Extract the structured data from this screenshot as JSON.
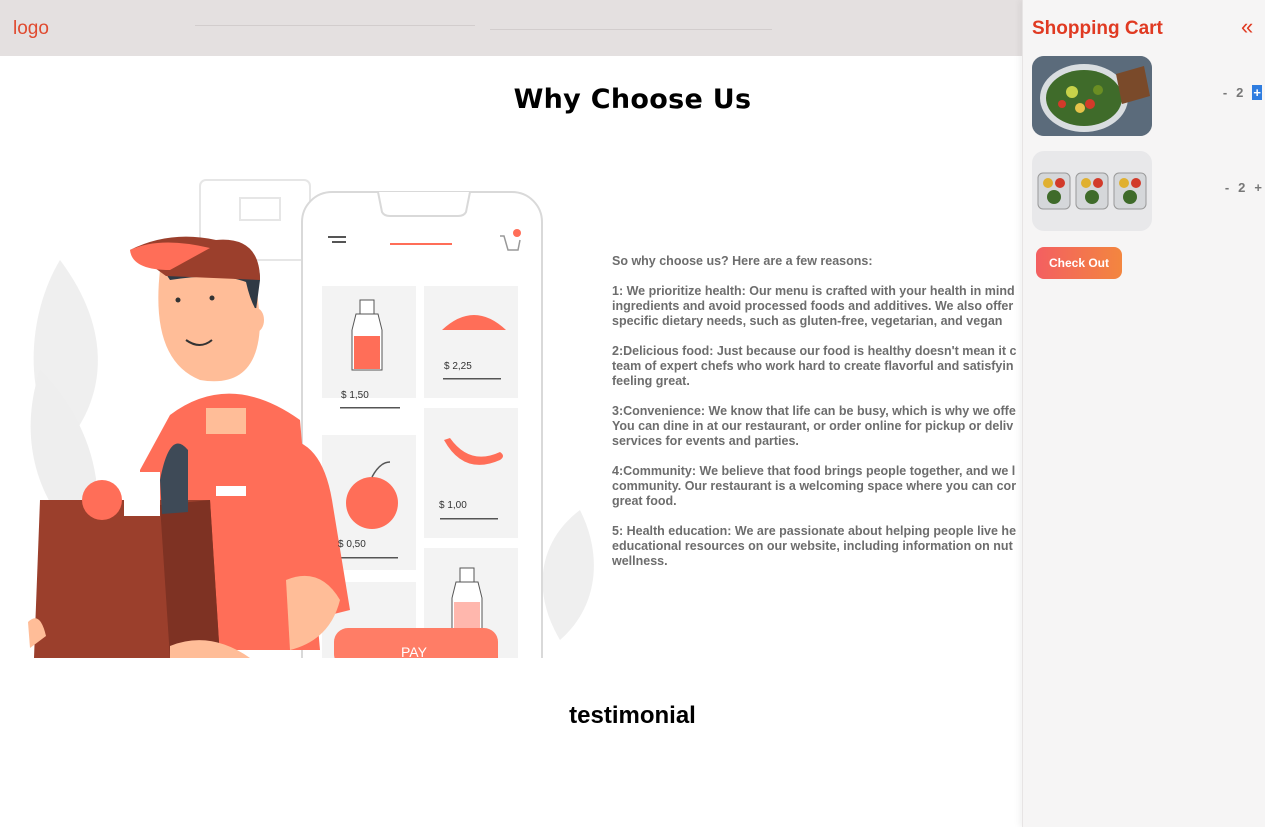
{
  "header": {
    "logo": "logo"
  },
  "why": {
    "title": "Why Choose Us",
    "intro": "So why choose us? Here are a few reasons:",
    "reasons": [
      [
        "1: We prioritize health: Our menu is crafted with your health in mind",
        "ingredients and avoid processed foods and additives. We also offer",
        "specific dietary needs, such as gluten-free, vegetarian, and vegan"
      ],
      [
        "2:Delicious food: Just because our food is healthy doesn't mean it c",
        "team of expert chefs who work hard to create flavorful and satisfyin",
        "feeling great."
      ],
      [
        "3:Convenience: We know that life can be busy, which is why we offe",
        "You can dine in at our restaurant, or order online for pickup or deliv",
        "services for events and parties."
      ],
      [
        "4:Community: We believe that food brings people together, and we l",
        "community. Our restaurant is a welcoming space where you can cor",
        "great food."
      ],
      [
        "5: Health education: We are passionate about helping people live he",
        "educational resources on our website, including information on nut",
        "wellness."
      ]
    ]
  },
  "illustration": {
    "prices": [
      "$ 1,50",
      "$ 2,25",
      "$ 1,00",
      "$ 0,50"
    ],
    "pay_label": "PAY"
  },
  "testimonial": {
    "title": "testimonial"
  },
  "cart": {
    "title": "Shopping Cart",
    "close_icon": "«",
    "items": [
      {
        "image": "salad-bowl-image",
        "minus": "-",
        "qty": "2",
        "plus": "+"
      },
      {
        "image": "meal-prep-containers-image",
        "minus": "-",
        "qty": "2",
        "plus": "+"
      }
    ],
    "checkout_label": "Check Out"
  },
  "colors": {
    "accent": "#e03a22",
    "brand_orange": "#ff6e58",
    "checkout_start": "#f35f61",
    "checkout_end": "#f3863f"
  }
}
